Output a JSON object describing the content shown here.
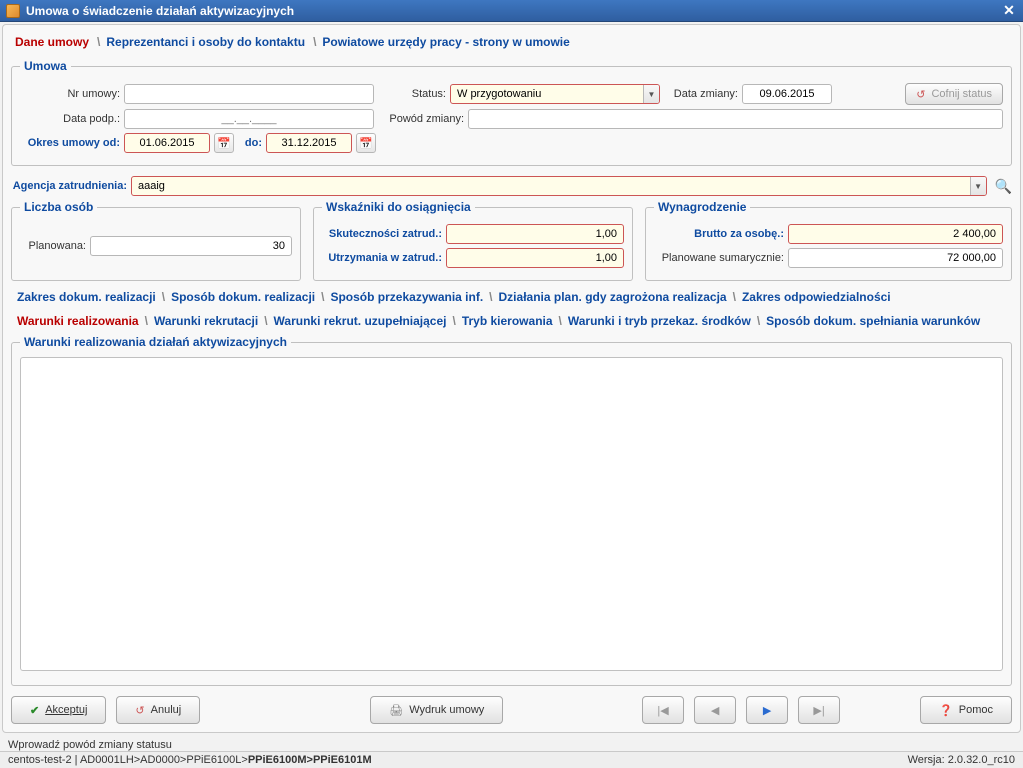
{
  "window": {
    "title": "Umowa o świadczenie działań aktywizacyjnych"
  },
  "top_tabs": [
    {
      "label": "Dane umowy"
    },
    {
      "label": "Reprezentanci i osoby do kontaktu"
    },
    {
      "label": "Powiatowe urzędy pracy - strony w umowie"
    }
  ],
  "umowa": {
    "legend": "Umowa",
    "nr_label": "Nr umowy:",
    "nr_value": "",
    "status_label": "Status:",
    "status_value": "W przygotowaniu",
    "data_zmiany_label": "Data zmiany:",
    "data_zmiany_value": "09.06.2015",
    "cofnij_btn": "Cofnij status",
    "data_podp_label": "Data podp.:",
    "data_podp_placeholder": "__.__.____",
    "data_podp_value": "",
    "powod_label": "Powód zmiany:",
    "powod_value": "",
    "okres_od_label": "Okres umowy od:",
    "okres_od_value": "01.06.2015",
    "okres_do_label": "do:",
    "okres_do_value": "31.12.2015"
  },
  "agencja": {
    "label": "Agencja zatrudnienia:",
    "value": "aaaig"
  },
  "liczba": {
    "legend": "Liczba osób",
    "planowana_label": "Planowana:",
    "planowana_value": "30"
  },
  "wskazniki": {
    "legend": "Wskaźniki do osiągnięcia",
    "sk_label": "Skuteczności zatrud.:",
    "sk_value": "1,00",
    "ut_label": "Utrzymania w zatrud.:",
    "ut_value": "1,00"
  },
  "wynagrodzenie": {
    "legend": "Wynagrodzenie",
    "brutto_label": "Brutto za osobę.:",
    "brutto_value": "2 400,00",
    "sum_label": "Planowane sumarycznie:",
    "sum_value": "72 000,00"
  },
  "sub_tabs_row1": [
    "Zakres dokum. realizacji",
    "Sposób dokum. realizacji",
    "Sposób przekazywania inf.",
    "Działania plan. gdy zagrożona realizacja",
    "Zakres odpowiedzialności"
  ],
  "sub_tabs_row2": [
    "Warunki realizowania",
    "Warunki rekrutacji",
    "Warunki rekrut. uzupełniającej",
    "Tryb kierowania",
    "Warunki i tryb przekaz. środków",
    "Sposób dokum. spełniania warunków"
  ],
  "big_area_legend": "Warunki realizowania działań aktywizacyjnych",
  "buttons": {
    "akceptuj": "Akceptuj",
    "anuluj": "Anuluj",
    "wydruk": "Wydruk umowy",
    "pomoc": "Pomoc"
  },
  "prompt": "Wprowadź powód zmiany statusu",
  "status": {
    "left": "centos-test-2 | AD0001LH>AD0000>PPiE6100L>",
    "bold": "PPiE6100M>PPiE6101M",
    "right": "Wersja: 2.0.32.0_rc10"
  }
}
